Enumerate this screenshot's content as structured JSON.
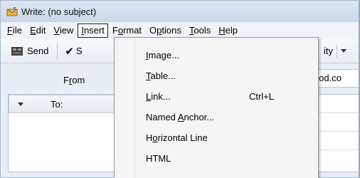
{
  "window": {
    "title": "Write: (no subject)"
  },
  "menubar": {
    "items": [
      {
        "label_pre": "",
        "mnemonic": "F",
        "label_post": "ile"
      },
      {
        "label_pre": "",
        "mnemonic": "E",
        "label_post": "dit"
      },
      {
        "label_pre": "",
        "mnemonic": "V",
        "label_post": "iew"
      },
      {
        "label_pre": "",
        "mnemonic": "I",
        "label_post": "nsert"
      },
      {
        "label_pre": "F",
        "mnemonic": "o",
        "label_post": "rmat"
      },
      {
        "label_pre": "O",
        "mnemonic": "p",
        "label_post": "tions"
      },
      {
        "label_pre": "",
        "mnemonic": "T",
        "label_post": "ools"
      },
      {
        "label_pre": "",
        "mnemonic": "H",
        "label_post": "elp"
      }
    ],
    "active_index": 3
  },
  "toolbar": {
    "send_label": "Send",
    "spell_label": "S",
    "security_label": "ity"
  },
  "header": {
    "from_label_pre": "F",
    "from_label_mnemonic": "r",
    "from_label_post": "om",
    "from_value": "lood.co",
    "to_label": "To:"
  },
  "insert_menu": {
    "items": [
      {
        "pre": "",
        "mnemonic": "I",
        "post": "mage...",
        "shortcut": ""
      },
      {
        "pre": "",
        "mnemonic": "T",
        "post": "able...",
        "shortcut": ""
      },
      {
        "pre": "",
        "mnemonic": "L",
        "post": "ink...",
        "shortcut": "Ctrl+L"
      },
      {
        "pre": "Named ",
        "mnemonic": "A",
        "post": "nchor...",
        "shortcut": ""
      },
      {
        "pre": "H",
        "mnemonic": "o",
        "post": "rizontal Line",
        "shortcut": ""
      },
      {
        "pre": "HTML",
        "mnemonic": "",
        "post": "",
        "shortcut": ""
      }
    ]
  },
  "colors": {
    "titlebar": "#cbd8e9",
    "menu_bg": "#f5f5f5",
    "accent_border": "#222222"
  }
}
